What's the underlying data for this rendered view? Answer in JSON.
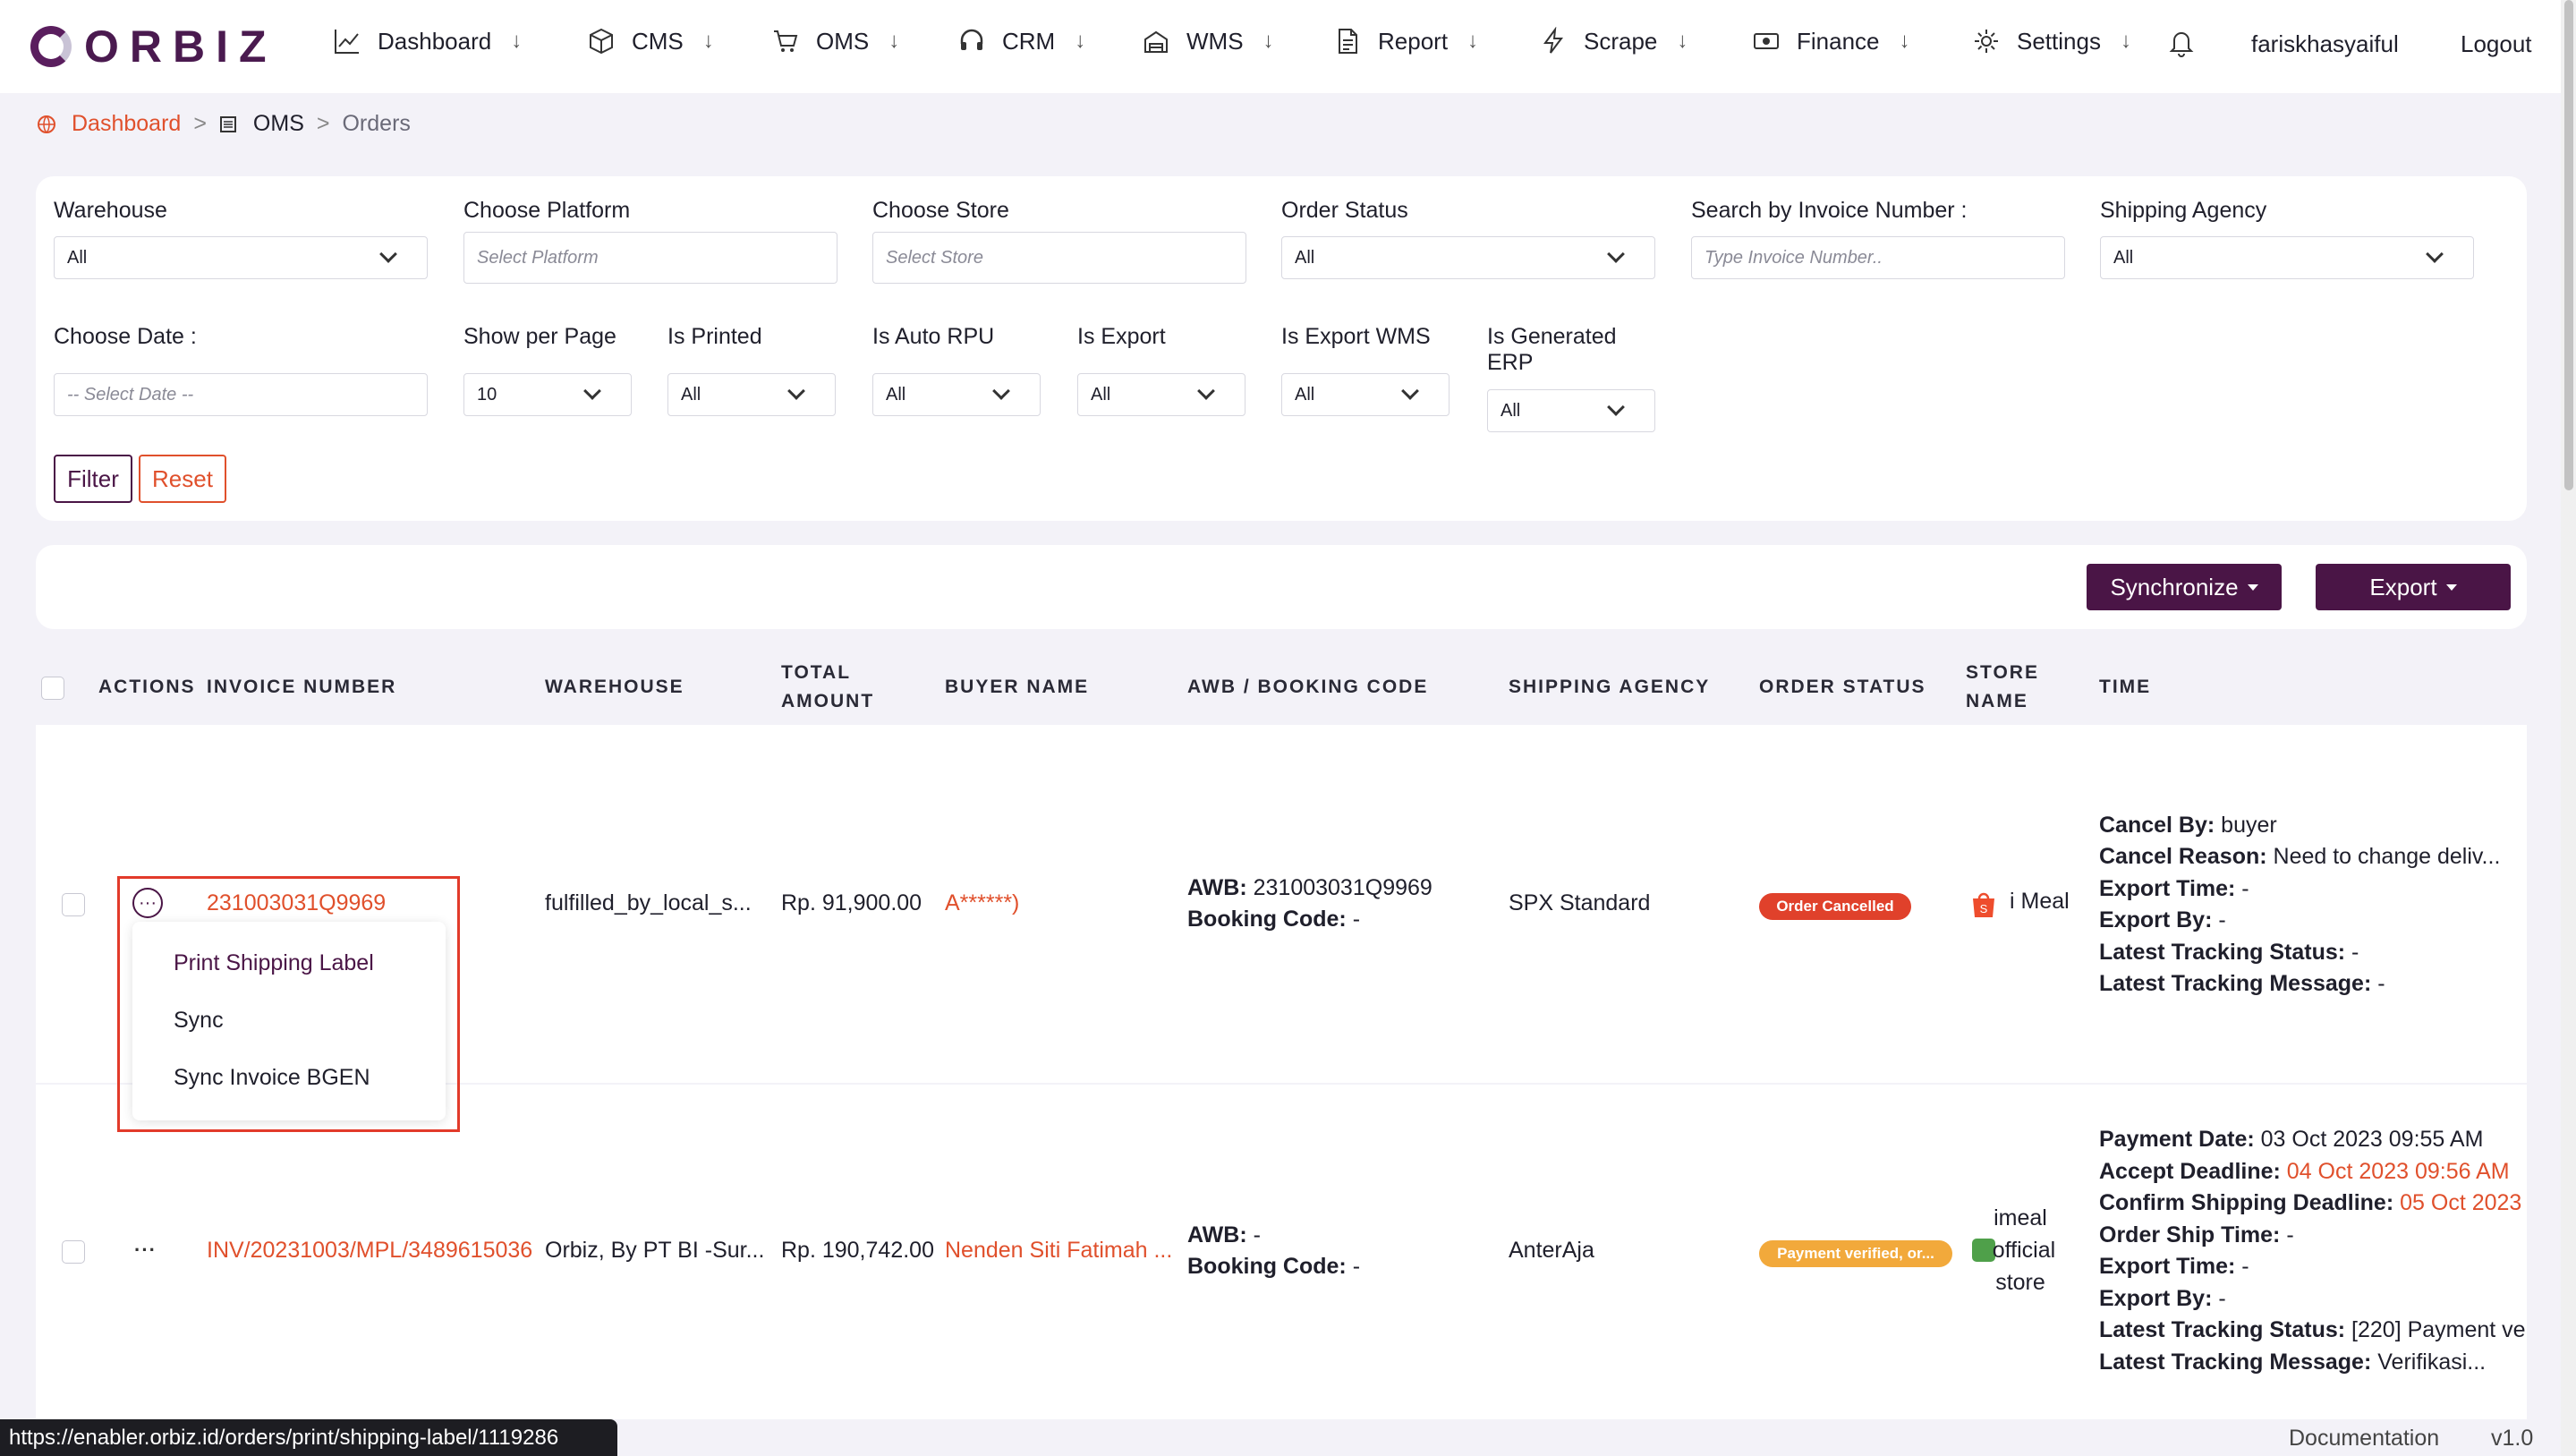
{
  "nav": {
    "logo": "ORBIZ",
    "items": [
      {
        "label": "Dashboard",
        "icon": "chart-line-icon"
      },
      {
        "label": "CMS",
        "icon": "box-icon"
      },
      {
        "label": "OMS",
        "icon": "cart-icon"
      },
      {
        "label": "CRM",
        "icon": "headset-icon"
      },
      {
        "label": "WMS",
        "icon": "warehouse-icon"
      },
      {
        "label": "Report",
        "icon": "document-icon"
      },
      {
        "label": "Scrape",
        "icon": "lightning-icon"
      },
      {
        "label": "Finance",
        "icon": "cash-icon"
      },
      {
        "label": "Settings",
        "icon": "gear-icon"
      }
    ],
    "arrow": "↓",
    "username": "fariskhasyaiful",
    "logout": "Logout"
  },
  "breadcrumb": {
    "dashboard": "Dashboard",
    "oms": "OMS",
    "orders": "Orders",
    "sep": ">"
  },
  "filters": {
    "warehouse_label": "Warehouse",
    "warehouse_value": "All",
    "platform_label": "Choose Platform",
    "platform_placeholder": "Select Platform",
    "store_label": "Choose Store",
    "store_placeholder": "Select Store",
    "order_status_label": "Order Status",
    "order_status_value": "All",
    "invoice_label": "Search by Invoice Number :",
    "invoice_placeholder": "Type Invoice Number..",
    "shipping_label": "Shipping Agency",
    "shipping_value": "All",
    "date_label": "Choose Date :",
    "date_placeholder": "-- Select Date --",
    "per_page_label": "Show per Page",
    "per_page_value": "10",
    "printed_label": "Is Printed",
    "printed_value": "All",
    "auto_rpu_label": "Is Auto RPU",
    "auto_rpu_value": "All",
    "export_label": "Is Export",
    "export_value": "All",
    "export_wms_label": "Is Export WMS",
    "export_wms_value": "All",
    "generated_erp_label_1": "Is Generated",
    "generated_erp_label_2": "ERP",
    "generated_erp_value": "All",
    "filter_button": "Filter",
    "reset_button": "Reset"
  },
  "actions": {
    "synchronize": "Synchronize",
    "export": "Export"
  },
  "table": {
    "headers": {
      "actions": "ACTIONS",
      "invoice": "INVOICE NUMBER",
      "warehouse": "WAREHOUSE",
      "total_1": "TOTAL",
      "total_2": "AMOUNT",
      "buyer": "BUYER NAME",
      "awb": "AWB / BOOKING CODE",
      "shipping": "SHIPPING AGENCY",
      "status": "ORDER STATUS",
      "store_1": "STORE",
      "store_2": "NAME",
      "time": "TIME"
    },
    "rows": [
      {
        "invoice": "231003031Q9969",
        "warehouse": "fulfilled_by_local_s...",
        "total": "Rp. 91,900.00",
        "buyer": "A******)",
        "awb_label": "AWB:",
        "awb_value": "231003031Q9969",
        "booking_label": "Booking Code:",
        "booking_value": "-",
        "shipping": "SPX Standard",
        "status": "Order Cancelled",
        "store": "i Meal",
        "time": [
          {
            "label": "Cancel By:",
            "value": "buyer"
          },
          {
            "label": "Cancel Reason:",
            "value": "Need to change deliv..."
          },
          {
            "label": "Export Time:",
            "value": "-"
          },
          {
            "label": "Export By:",
            "value": "-"
          },
          {
            "label": "Latest Tracking Status:",
            "value": "-"
          },
          {
            "label": "Latest Tracking Message:",
            "value": "-"
          }
        ]
      },
      {
        "invoice": "INV/20231003/MPL/3489615036",
        "warehouse": "Orbiz, By PT BI -Sur...",
        "total": "Rp. 190,742.00",
        "buyer": "Nenden Siti Fatimah ...",
        "awb_label": "AWB:",
        "awb_value": "-",
        "booking_label": "Booking Code:",
        "booking_value": "-",
        "shipping": "AnterAja",
        "status": "Payment verified, or...",
        "store_1": "imeal",
        "store_2": "official",
        "store_3": "store",
        "time": [
          {
            "label": "Payment Date:",
            "value": "03 Oct 2023 09:55 AM"
          },
          {
            "label": "Accept Deadline:",
            "value": "04 Oct 2023 09:56 AM"
          },
          {
            "label": "Confirm Shipping Deadline:",
            "value": "05 Oct 2023"
          },
          {
            "label": "Order Ship Time:",
            "value": "-"
          },
          {
            "label": "Export Time:",
            "value": "-"
          },
          {
            "label": "Export By:",
            "value": "-"
          },
          {
            "label": "Latest Tracking Status:",
            "value": "[220] Payment ve"
          },
          {
            "label": "Latest Tracking Message:",
            "value": "Verifikasi..."
          }
        ]
      }
    ]
  },
  "dropdown_menu": {
    "items": [
      "Print Shipping Label",
      "Sync",
      "Sync Invoice BGEN"
    ]
  },
  "status_url": "https://enabler.orbiz.id/orders/print/shipping-label/1119286",
  "footer": {
    "documentation": "Documentation",
    "version": "v1.0"
  },
  "colors": {
    "accent": "#e0502c",
    "brand": "#4a1546",
    "cancelled": "#e0412b",
    "verified": "#f2a93b"
  }
}
